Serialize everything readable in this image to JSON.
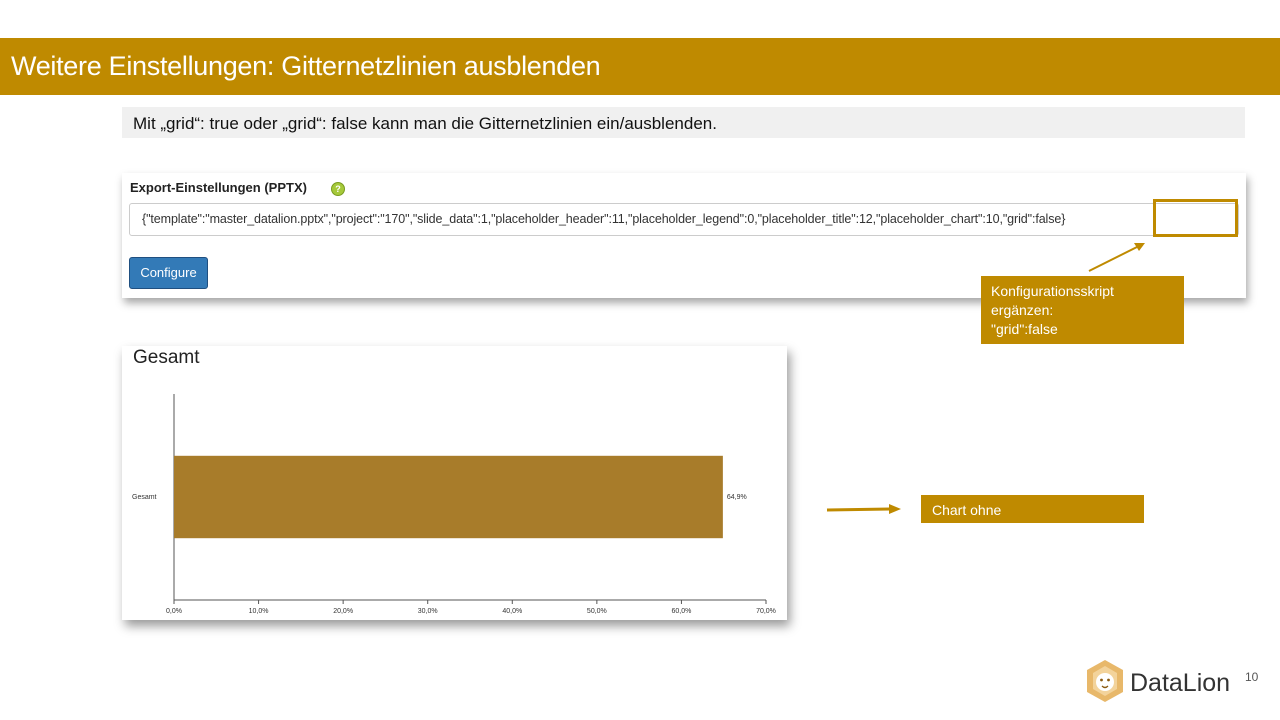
{
  "slide": {
    "title": "Weitere Einstellungen: Gitternetzlinien ausblenden",
    "subtitle": "Mit „grid“: true oder „grid“: false kann man die Gitternetzlinien ein/ausblenden.",
    "page_number": "10"
  },
  "export": {
    "label": "Export-Einstellungen (PPTX)",
    "help_icon": "question-circle-icon",
    "input_value": "{\"template\":\"master_datalion.pptx\",\"project\":\"170\",\"slide_data\":1,\"placeholder_header\":11,\"placeholder_legend\":0,\"placeholder_title\":12,\"placeholder_chart\":10,\"grid\":false}",
    "configure_label": "Configure"
  },
  "callouts": {
    "script_lines": [
      "Konfigurationsskript",
      "ergänzen:",
      "\"grid\":false"
    ],
    "chart_text": "Chart ohne"
  },
  "colors": {
    "accent": "#bf8a00",
    "bar": "#a87c2a",
    "button": "#337ab7"
  },
  "logo": {
    "text": "DataLion",
    "icon": "lion-icon"
  },
  "chart_data": {
    "type": "bar",
    "orientation": "horizontal",
    "title": "Gesamt",
    "categories": [
      "Gesamt"
    ],
    "values": [
      64.9
    ],
    "data_labels": [
      "64,9%"
    ],
    "xlim": [
      0,
      70
    ],
    "xticks": [
      "0,0%",
      "10,0%",
      "20,0%",
      "30,0%",
      "40,0%",
      "50,0%",
      "60,0%",
      "70,0%"
    ],
    "grid": false
  }
}
